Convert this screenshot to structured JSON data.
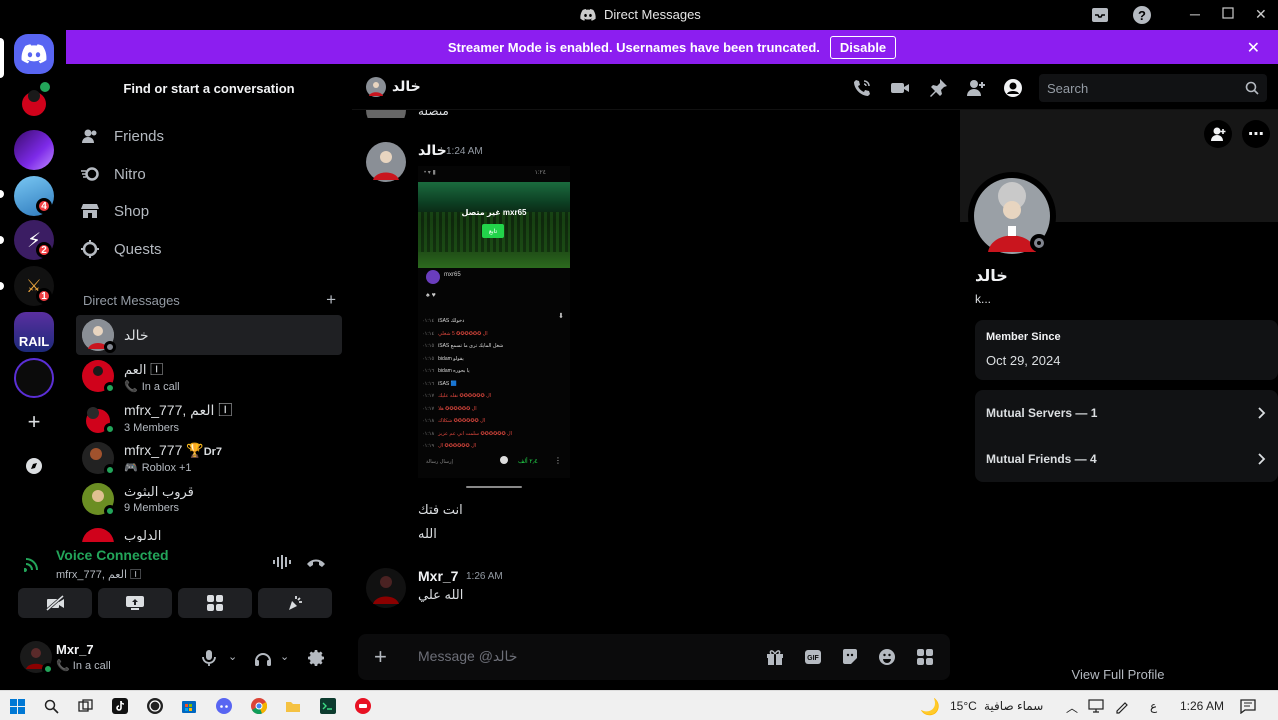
{
  "window": {
    "title": "Direct Messages"
  },
  "banner": {
    "text": "Streamer Mode is enabled. Usernames have been truncated.",
    "button_label": "Disable"
  },
  "server_rail": {
    "badges": [
      "4",
      "2",
      "1"
    ],
    "rail_text": "RAIL"
  },
  "sidebar": {
    "find_label": "Find or start a conversation",
    "nav": [
      {
        "label": "Friends",
        "icon": "friends-icon"
      },
      {
        "label": "Nitro",
        "icon": "nitro-icon"
      },
      {
        "label": "Shop",
        "icon": "shop-icon"
      },
      {
        "label": "Quests",
        "icon": "quests-icon"
      }
    ],
    "dm_header": "Direct Messages",
    "dms": [
      {
        "name": "خالد",
        "sub": ""
      },
      {
        "name": "العم 🄸",
        "sub": "In a call"
      },
      {
        "name": "mfrx_777, العم 🄸",
        "sub": "3 Members"
      },
      {
        "name": "mfrx_777",
        "badge": "Dr7",
        "sub": "Roblox +1"
      },
      {
        "name": "قروب البثوث",
        "sub": "9 Members"
      },
      {
        "name": "الدلوب",
        "sub": ""
      }
    ]
  },
  "voice": {
    "status": "Voice Connected",
    "channel": "mfrx_777, العم 🄸"
  },
  "user": {
    "name": "Mxr_7",
    "status": "In a call"
  },
  "chat": {
    "name": "خالد",
    "search_placeholder": "Search",
    "top_partial": "متصلة",
    "messages": [
      {
        "author": "خالد",
        "time": "1:24 AM",
        "image": {
          "time": "١:٢٤",
          "header_text": "غير متصل mxr65",
          "button": "تابع",
          "username": "mxr65",
          "rows": [
            {
              "time": "٠١:١٤",
              "text": "iSAS دخولك"
            },
            {
              "time": "٠١:١٤",
              "text": "ال ✪✪✪✪✪✪ 5 شغلي"
            },
            {
              "time": "٠١:١٥",
              "text": "iSAS شغل المايك ترى ما تسمع"
            },
            {
              "time": "٠١:١٥",
              "text": "bidam يقولو"
            },
            {
              "time": "٠١:١٦",
              "text": "bidam يا بحوره"
            },
            {
              "time": "٠١:١٦",
              "text": "iSAS 🟦"
            },
            {
              "time": "٠١:١٧",
              "text": "ال ✪✪✪✪✪✪ نقله عليك"
            },
            {
              "time": "٠١:١٧",
              "text": "ال ✪✪✪✪✪✪ هلا"
            },
            {
              "time": "٠١:١٨",
              "text": "ال ✪✪✪✪✪✪ شكلاك"
            },
            {
              "time": "٠١:١٨",
              "text": "ال ✪✪✪✪✪✪ سلمت اني عم عزيز"
            },
            {
              "time": "٠١:١٩",
              "text": "ال ✪✪✪✪✪✪ ال"
            }
          ],
          "footer_left": "إرسال رسالة",
          "footer_count": "٢٫٤ ألف"
        },
        "lines": [
          "انت فتك",
          "الله"
        ]
      },
      {
        "author": "Mxr_7",
        "time": "1:26 AM",
        "lines": [
          "الله علي"
        ]
      }
    ],
    "composer_placeholder": "Message @خالد"
  },
  "profile": {
    "name": "خالد",
    "username": "k...",
    "member_since_label": "Member Since",
    "member_since": "Oct 29, 2024",
    "mutual_servers": "Mutual Servers — 1",
    "mutual_friends": "Mutual Friends — 4",
    "view_full": "View Full Profile"
  },
  "taskbar": {
    "temperature": "15°C",
    "weather": "سماء صافية",
    "lang": "ع",
    "time": "1:26 AM"
  },
  "colors": {
    "banner": "#8c1ef0",
    "online": "#23a55a",
    "badge": "#f23f43",
    "blurple": "#5865f2"
  }
}
